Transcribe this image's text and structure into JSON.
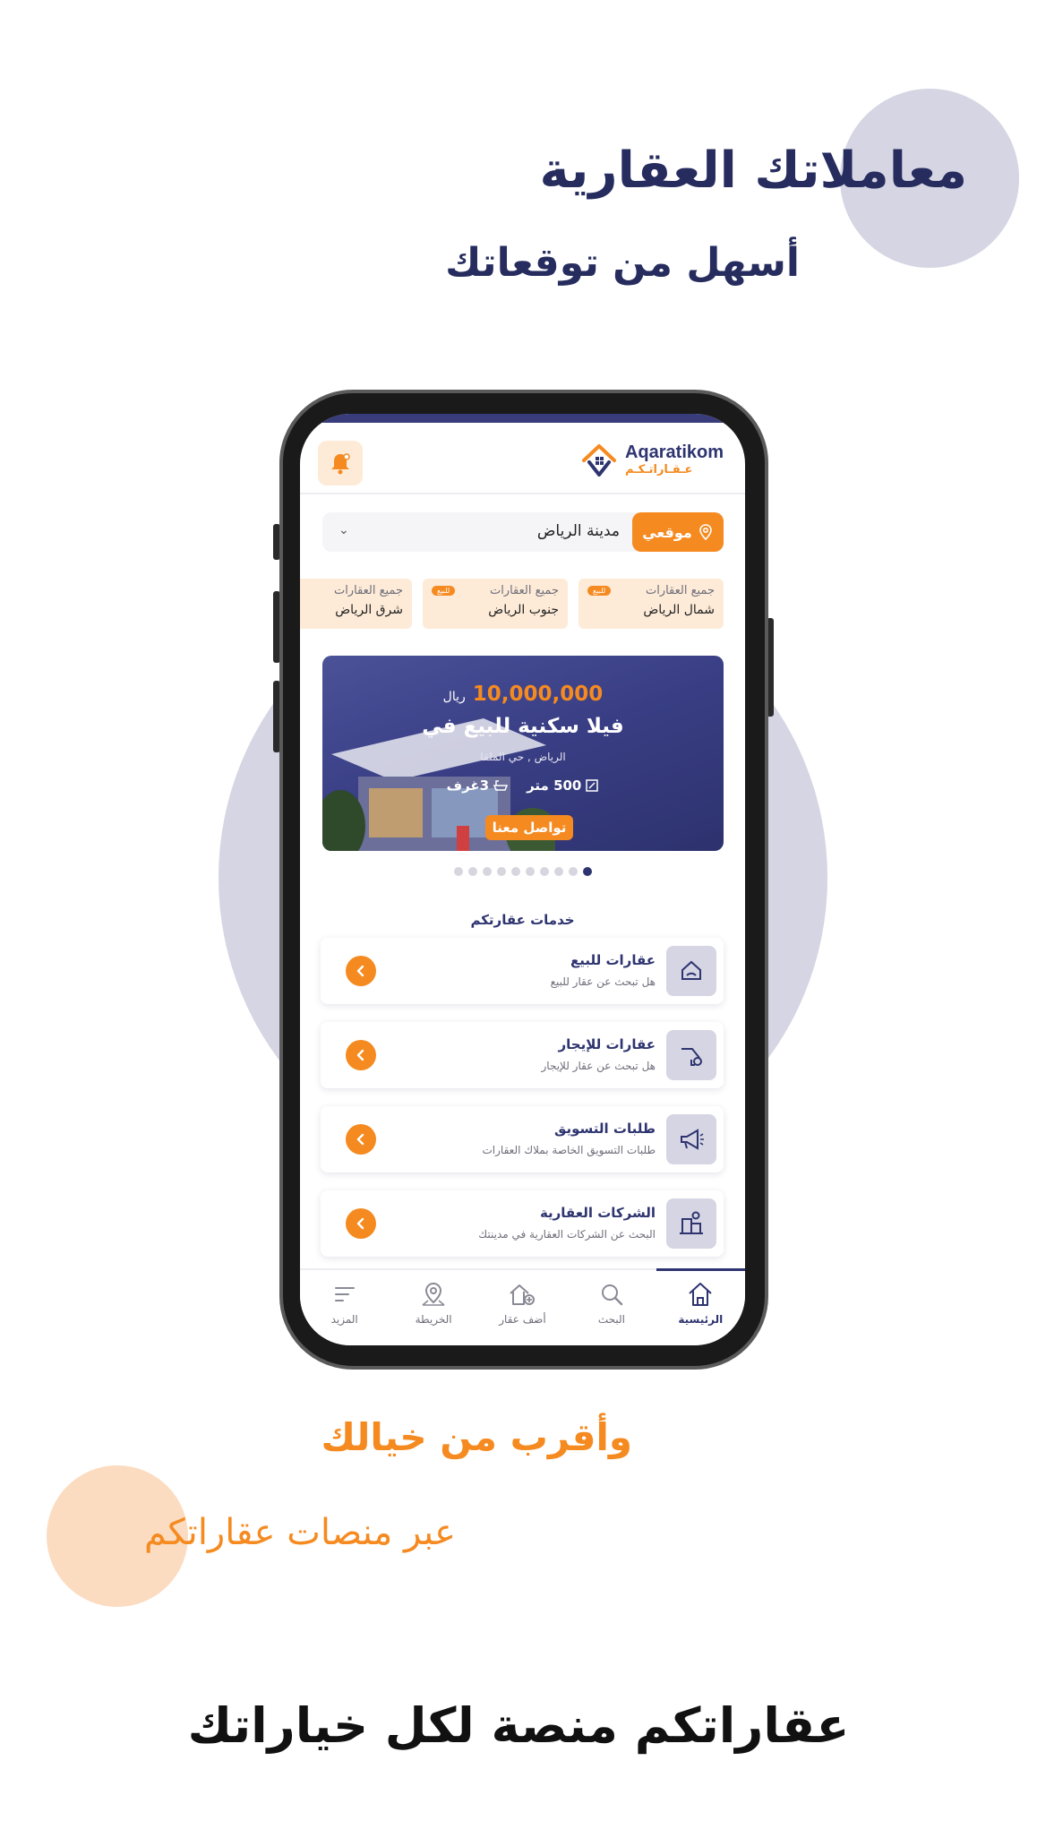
{
  "promo": {
    "headline_1": "معاملاتك العقارية",
    "headline_2": "أسهل من توقعاتك",
    "tagline_1": "وأقرب من خيالك",
    "tagline_2": "عبر منصات عقاراتكم",
    "footer_title": "عقاراتكم منصة لكل خياراتك"
  },
  "colors": {
    "brand_navy": "#2e3470",
    "brand_orange": "#f58a20",
    "circle_lilac": "#d5d5e3",
    "circle_peach": "#fbdcc0"
  },
  "app": {
    "logo_latin": "Aqaratikom",
    "logo_arabic": "عـقـاراتـكـم",
    "bell_icon": "bell-icon",
    "location": {
      "button_label": "موقعي",
      "city": "مدينة الرياض",
      "chevron": "⌄"
    },
    "areas": [
      {
        "label": "جميع العقارات",
        "badge": "للبيع",
        "name": "شمال الرياض"
      },
      {
        "label": "جميع العقارات",
        "badge": "للبيع",
        "name": "جنوب الرياض"
      },
      {
        "label": "جميع العقارات",
        "badge": "",
        "name": "شرق الرياض"
      }
    ],
    "banner": {
      "price": "10,000,000",
      "currency": "ريال",
      "title": "فيلا سكنية للبيع في",
      "location": "الرياض , حي الملقا",
      "area": "500 متر",
      "rooms": "3غرف",
      "cta": "تواصل معنا"
    },
    "carousel": {
      "total": 10,
      "active_index": 0
    },
    "services_title": "خدمات عقارتكم",
    "services": [
      {
        "title": "عقارات للبيع",
        "subtitle": "هل تبحث عن عقار للبيع",
        "icon": "house-hand-icon"
      },
      {
        "title": "عقارات للإيجار",
        "subtitle": "هل تبحث عن عقار للإيجار",
        "icon": "key-hand-icon"
      },
      {
        "title": "طلبات التسويق",
        "subtitle": "طلبات التسويق الخاصة بملاك العقارات",
        "icon": "megaphone-icon"
      },
      {
        "title": "الشركات العقارية",
        "subtitle": "البحث عن الشركات العقارية في مدينتك",
        "icon": "buildings-icon"
      }
    ],
    "nav": [
      {
        "label": "الرئيسية",
        "icon": "home-icon",
        "active": true
      },
      {
        "label": "البحث",
        "icon": "search-icon",
        "active": false
      },
      {
        "label": "أضف عقار",
        "icon": "add-property-icon",
        "active": false
      },
      {
        "label": "الخريطة",
        "icon": "map-pin-icon",
        "active": false
      },
      {
        "label": "المزيد",
        "icon": "menu-icon",
        "active": false
      }
    ]
  }
}
